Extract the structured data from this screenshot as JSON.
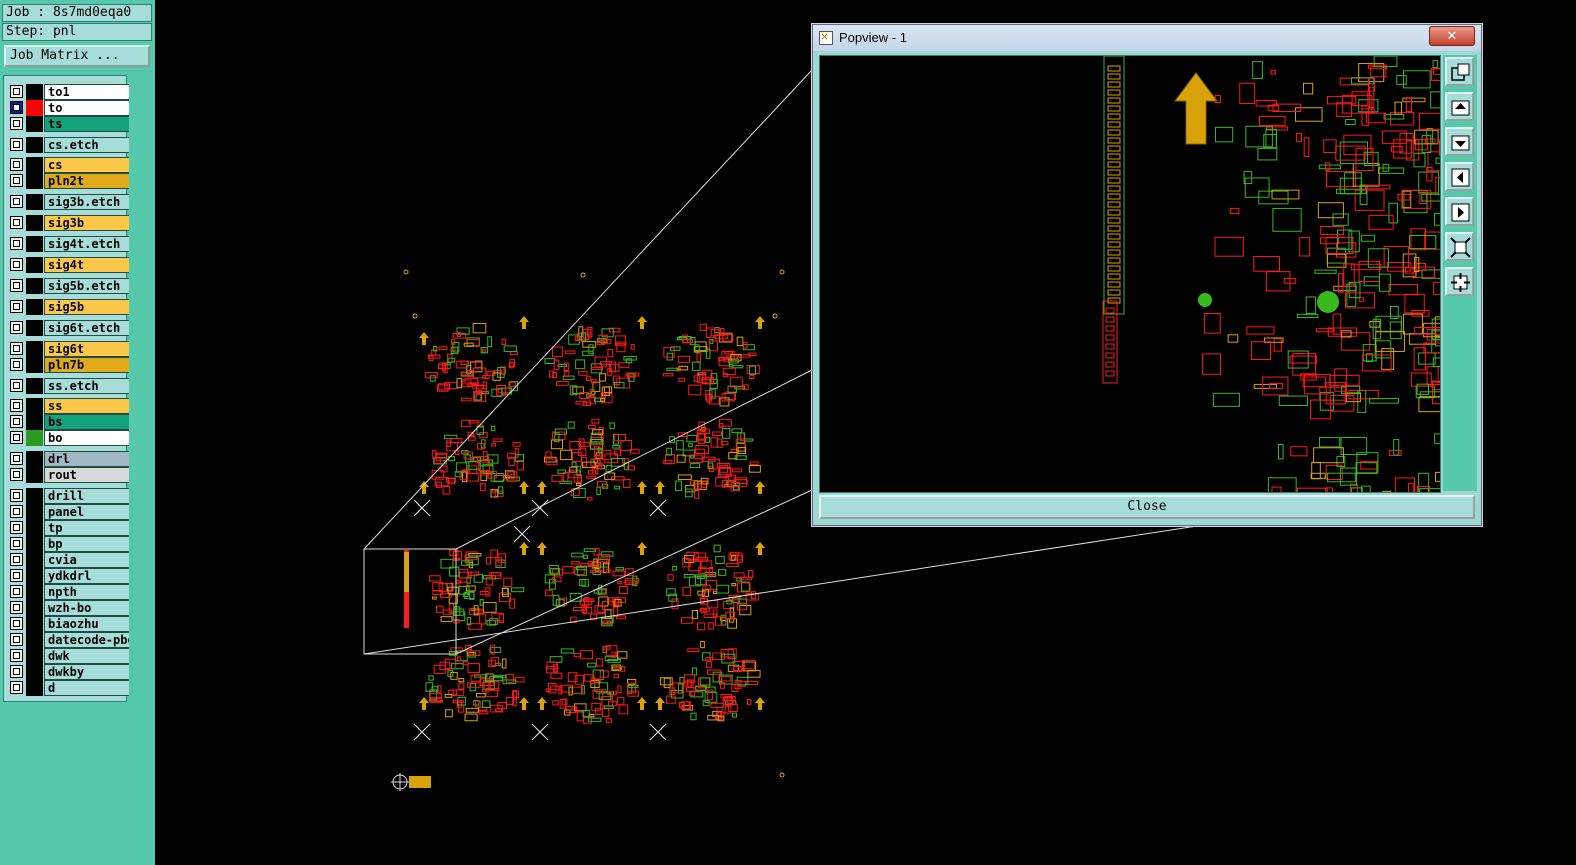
{
  "job": {
    "label": "Job : 8s7md0eqa0",
    "step": "Step: pnl",
    "matrix_button": "Job Matrix ..."
  },
  "layers": [
    {
      "name": "to1",
      "color": "#ffffff",
      "swatch": "#000000"
    },
    {
      "name": "to",
      "color": "#ffffff",
      "swatch": "#ff0000",
      "active": true
    },
    {
      "name": "ts",
      "color": "#12a37c",
      "swatch": "#000000"
    },
    {
      "name": "cs.etch",
      "color": "#a6ddd8",
      "swatch": "#000000"
    },
    {
      "name": "cs",
      "color": "#fdc84a",
      "swatch": "#000000"
    },
    {
      "name": "pln2t",
      "color": "#e0aa1a",
      "swatch": "#000000"
    },
    {
      "name": "sig3b.etch",
      "color": "#a6ddd8",
      "swatch": "#000000"
    },
    {
      "name": "sig3b",
      "color": "#fdc84a",
      "swatch": "#000000"
    },
    {
      "name": "sig4t.etch",
      "color": "#a6ddd8",
      "swatch": "#000000"
    },
    {
      "name": "sig4t",
      "color": "#fdc84a",
      "swatch": "#000000"
    },
    {
      "name": "sig5b.etch",
      "color": "#a6ddd8",
      "swatch": "#000000"
    },
    {
      "name": "sig5b",
      "color": "#fdc84a",
      "swatch": "#000000"
    },
    {
      "name": "sig6t.etch",
      "color": "#a6ddd8",
      "swatch": "#000000"
    },
    {
      "name": "sig6t",
      "color": "#fdc84a",
      "swatch": "#000000"
    },
    {
      "name": "pln7b",
      "color": "#e0aa1a",
      "swatch": "#000000"
    },
    {
      "name": "ss.etch",
      "color": "#a6ddd8",
      "swatch": "#000000"
    },
    {
      "name": "ss",
      "color": "#fdc84a",
      "swatch": "#000000"
    },
    {
      "name": "bs",
      "color": "#12a37c",
      "swatch": "#000000"
    },
    {
      "name": "bo",
      "color": "#ffffff",
      "swatch": "#2d9b1f"
    },
    {
      "name": "drl",
      "color": "#9fb8c4",
      "swatch": "#000000"
    },
    {
      "name": "rout",
      "color": "#d9d9d9",
      "swatch": "#000000"
    },
    {
      "name": "drill",
      "color": "#a6ddd8",
      "swatch": "#000000"
    },
    {
      "name": "panel",
      "color": "#a6ddd8",
      "swatch": "#000000"
    },
    {
      "name": "tp",
      "color": "#a6ddd8",
      "swatch": "#000000"
    },
    {
      "name": "bp",
      "color": "#a6ddd8",
      "swatch": "#000000"
    },
    {
      "name": "cvia",
      "color": "#a6ddd8",
      "swatch": "#000000"
    },
    {
      "name": "ydkdrl",
      "color": "#a6ddd8",
      "swatch": "#000000"
    },
    {
      "name": "npth",
      "color": "#a6ddd8",
      "swatch": "#000000"
    },
    {
      "name": "wzh-bo",
      "color": "#a6ddd8",
      "swatch": "#000000"
    },
    {
      "name": "biaozhu",
      "color": "#a6ddd8",
      "swatch": "#000000"
    },
    {
      "name": "datecode-pbo",
      "color": "#a6ddd8",
      "swatch": "#000000"
    },
    {
      "name": "dwk",
      "color": "#a6ddd8",
      "swatch": "#000000"
    },
    {
      "name": "dwkby",
      "color": "#a6ddd8",
      "swatch": "#000000"
    },
    {
      "name": "d",
      "color": "#a6ddd8",
      "swatch": "#000000"
    }
  ],
  "popview": {
    "title": "Popview - 1",
    "close_label": "Close",
    "close_x": "✕"
  },
  "tools": [
    "zoom-fit-icon",
    "pan-up-icon",
    "pan-down-icon",
    "pan-left-icon",
    "pan-right-icon",
    "zoom-in-icon",
    "zoom-out-icon"
  ],
  "colors": {
    "panel": "#56c9ad",
    "field": "#a6ddd8",
    "trace_red": "#ff1a1a",
    "trace_green": "#39b91c",
    "trace_gold": "#d9a20b"
  }
}
